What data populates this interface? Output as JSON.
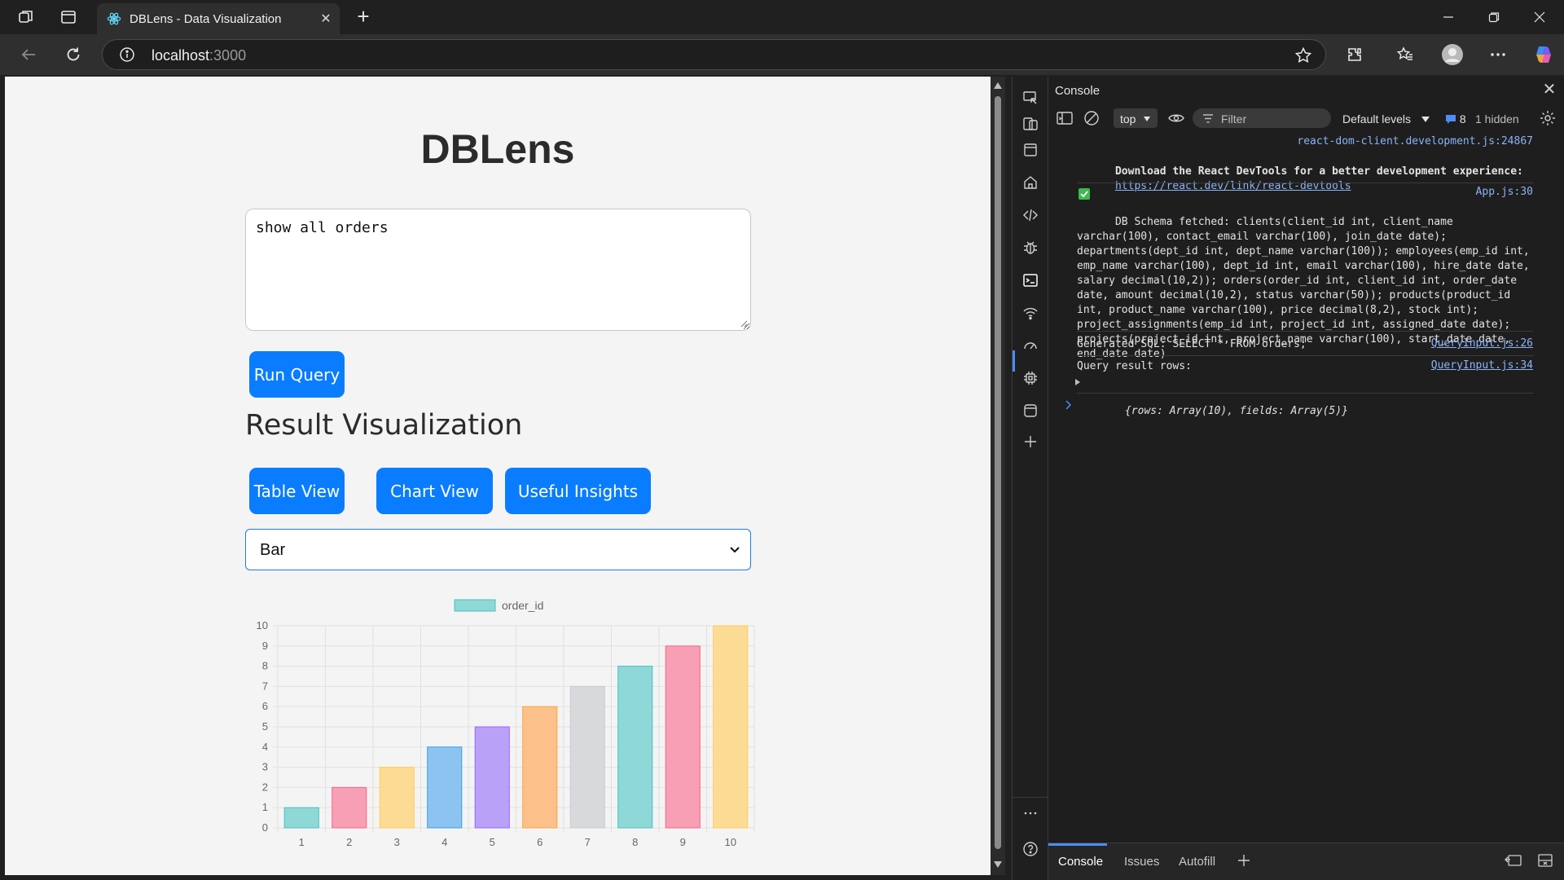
{
  "browser": {
    "tab_title": "DBLens - Data Visualization",
    "new_tab_label": "+",
    "url_host": "localhost",
    "url_port": ":3000"
  },
  "page": {
    "title": "DBLens",
    "query_text": "show all orders",
    "run_button": "Run Query",
    "section_title": "Result Visualization",
    "buttons": [
      "Table View",
      "Chart View",
      "Useful Insights"
    ],
    "chart_type_selected": "Bar"
  },
  "chart_data": {
    "type": "bar",
    "categories": [
      "1",
      "2",
      "3",
      "4",
      "5",
      "6",
      "7",
      "8",
      "9",
      "10"
    ],
    "series": [
      {
        "name": "order_id",
        "values": [
          1,
          2,
          3,
          4,
          5,
          6,
          7,
          8,
          9,
          10
        ]
      }
    ],
    "ylim": [
      0,
      10
    ],
    "yticks": [
      "0",
      "1",
      "2",
      "3",
      "4",
      "5",
      "6",
      "7",
      "8",
      "9",
      "10"
    ],
    "grid": true,
    "legend_position": "top",
    "colors": [
      "#8fd8d8",
      "#f7a0b5",
      "#fcdc95",
      "#8cc3f1",
      "#b9a1f8",
      "#fcc18a",
      "#d8d9db",
      "#8fd8d8",
      "#f7a0b5",
      "#fcdc95"
    ],
    "border_colors": [
      "#4bc0c0",
      "#ff6384",
      "#ffcd56",
      "#36a2eb",
      "#9966ff",
      "#ff9f40",
      "#c9cbcf",
      "#4bc0c0",
      "#ff6384",
      "#ffcd56"
    ]
  },
  "devtools": {
    "panel_title": "Console",
    "context": "top",
    "filter_placeholder": "Filter",
    "levels": "Default levels",
    "issues_count": "8",
    "hidden_count": "1 hidden",
    "messages": {
      "m1_source": "react-dom-client.development.js:24867",
      "m1_line1": "Download the React DevTools for a better development experience:",
      "m1_link": "https://react.dev/link/react-devtools",
      "m2_source": "App.js:30",
      "m2_text": "DB Schema fetched: clients(client_id int, client_name varchar(100), contact_email varchar(100), join_date date); departments(dept_id int, dept_name varchar(100)); employees(emp_id int, emp_name varchar(100), dept_id int, email varchar(100), hire_date date, salary decimal(10,2)); orders(order_id int, client_id int, order_date date, amount decimal(10,2), status varchar(50)); products(product_id int, product_name varchar(100), price decimal(8,2), stock int); project_assignments(emp_id int, project_id int, assigned_date date); projects(project_id int, project_name varchar(100), start_date date, end_date date)",
      "m3_source": "QueryInput.js:26",
      "m3_text": "Generated SQL: SELECT * FROM orders;",
      "m4_source": "QueryInput.js:34",
      "m4_text": "Query result rows:",
      "m4_object": "{rows: Array(10), fields: Array(5)}"
    },
    "drawer_tabs": [
      "Console",
      "Issues",
      "Autofill"
    ]
  }
}
